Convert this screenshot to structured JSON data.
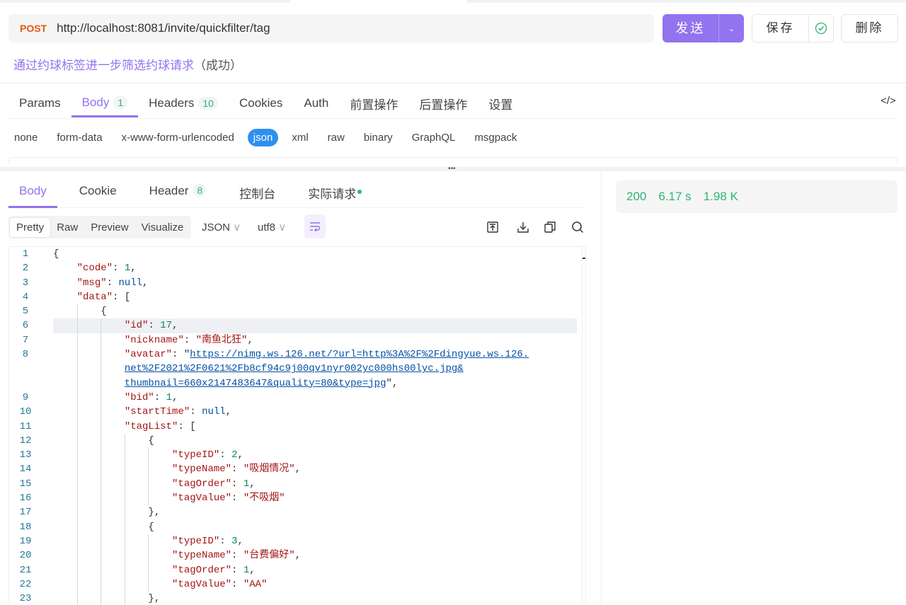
{
  "request": {
    "method": "POST",
    "url": "http://localhost:8081/invite/quickfilter/tag",
    "send_label": "发送",
    "save_label": "保存",
    "delete_label": "删除"
  },
  "description": {
    "title": "通过约球标签进一步筛选约球请求",
    "status": "（成功）"
  },
  "request_tabs": [
    {
      "label": "Params"
    },
    {
      "label": "Body",
      "badge": "1"
    },
    {
      "label": "Headers",
      "badge": "10"
    },
    {
      "label": "Cookies"
    },
    {
      "label": "Auth"
    },
    {
      "label": "前置操作"
    },
    {
      "label": "后置操作"
    },
    {
      "label": "设置"
    }
  ],
  "body_types": [
    "none",
    "form-data",
    "x-www-form-urlencoded",
    "json",
    "xml",
    "raw",
    "binary",
    "GraphQL",
    "msgpack"
  ],
  "response_tabs": [
    {
      "label": "Body"
    },
    {
      "label": "Cookie"
    },
    {
      "label": "Header",
      "badge": "8"
    },
    {
      "label": "控制台"
    },
    {
      "label": "实际请求"
    }
  ],
  "view_modes": [
    "Pretty",
    "Raw",
    "Preview",
    "Visualize"
  ],
  "format_select": "JSON",
  "encoding_select": "utf8",
  "response_status": {
    "code": "200",
    "time": "6.17 s",
    "size": "1.98 K"
  },
  "code_lines": [
    {
      "n": "1",
      "i": 0,
      "t": [
        [
          "p",
          "{"
        ]
      ]
    },
    {
      "n": "2",
      "i": 1,
      "t": [
        [
          "k",
          "\"code\""
        ],
        [
          "p",
          ": "
        ],
        [
          "n",
          "1"
        ],
        [
          "p",
          ","
        ]
      ]
    },
    {
      "n": "3",
      "i": 1,
      "t": [
        [
          "k",
          "\"msg\""
        ],
        [
          "p",
          ": "
        ],
        [
          "nl",
          "null"
        ],
        [
          "p",
          ","
        ]
      ]
    },
    {
      "n": "4",
      "i": 1,
      "t": [
        [
          "k",
          "\"data\""
        ],
        [
          "p",
          ": ["
        ]
      ]
    },
    {
      "n": "5",
      "i": 2,
      "t": [
        [
          "p",
          "{"
        ]
      ]
    },
    {
      "n": "6",
      "i": 3,
      "t": [
        [
          "k",
          "\"id\""
        ],
        [
          "p",
          ": "
        ],
        [
          "n",
          "17"
        ],
        [
          "p",
          ","
        ]
      ],
      "hl": true
    },
    {
      "n": "7",
      "i": 3,
      "t": [
        [
          "k",
          "\"nickname\""
        ],
        [
          "p",
          ": "
        ],
        [
          "s",
          "\"南鱼北狂\""
        ],
        [
          "p",
          ","
        ]
      ]
    },
    {
      "n": "8",
      "i": 3,
      "t": [
        [
          "k",
          "\"avatar\""
        ],
        [
          "p",
          ": \""
        ],
        [
          "u",
          "https://nimg.ws.126.net/?url=http%3A%2F%2Fdingyue.ws.126."
        ]
      ]
    },
    {
      "n": "",
      "i": 3,
      "t": [
        [
          "u",
          "net%2F2021%2F0621%2Fb8cf94c9j00qv1nyr002yc000hs00lyc.jpg&"
        ]
      ]
    },
    {
      "n": "",
      "i": 3,
      "t": [
        [
          "u",
          "thumbnail=660x2147483647&quality=80&type=jpg"
        ],
        [
          "p",
          "\","
        ]
      ]
    },
    {
      "n": "9",
      "i": 3,
      "t": [
        [
          "k",
          "\"bid\""
        ],
        [
          "p",
          ": "
        ],
        [
          "n",
          "1"
        ],
        [
          "p",
          ","
        ]
      ]
    },
    {
      "n": "10",
      "i": 3,
      "t": [
        [
          "k",
          "\"startTime\""
        ],
        [
          "p",
          ": "
        ],
        [
          "nl",
          "null"
        ],
        [
          "p",
          ","
        ]
      ]
    },
    {
      "n": "11",
      "i": 3,
      "t": [
        [
          "k",
          "\"tagList\""
        ],
        [
          "p",
          ": ["
        ]
      ]
    },
    {
      "n": "12",
      "i": 4,
      "t": [
        [
          "p",
          "{"
        ]
      ]
    },
    {
      "n": "13",
      "i": 5,
      "t": [
        [
          "k",
          "\"typeID\""
        ],
        [
          "p",
          ": "
        ],
        [
          "n",
          "2"
        ],
        [
          "p",
          ","
        ]
      ]
    },
    {
      "n": "14",
      "i": 5,
      "t": [
        [
          "k",
          "\"typeName\""
        ],
        [
          "p",
          ": "
        ],
        [
          "s",
          "\"吸烟情况\""
        ],
        [
          "p",
          ","
        ]
      ]
    },
    {
      "n": "15",
      "i": 5,
      "t": [
        [
          "k",
          "\"tagOrder\""
        ],
        [
          "p",
          ": "
        ],
        [
          "n",
          "1"
        ],
        [
          "p",
          ","
        ]
      ]
    },
    {
      "n": "16",
      "i": 5,
      "t": [
        [
          "k",
          "\"tagValue\""
        ],
        [
          "p",
          ": "
        ],
        [
          "s",
          "\"不吸烟\""
        ]
      ]
    },
    {
      "n": "17",
      "i": 4,
      "t": [
        [
          "p",
          "},"
        ]
      ]
    },
    {
      "n": "18",
      "i": 4,
      "t": [
        [
          "p",
          "{"
        ]
      ]
    },
    {
      "n": "19",
      "i": 5,
      "t": [
        [
          "k",
          "\"typeID\""
        ],
        [
          "p",
          ": "
        ],
        [
          "n",
          "3"
        ],
        [
          "p",
          ","
        ]
      ]
    },
    {
      "n": "20",
      "i": 5,
      "t": [
        [
          "k",
          "\"typeName\""
        ],
        [
          "p",
          ": "
        ],
        [
          "s",
          "\"台费偏好\""
        ],
        [
          "p",
          ","
        ]
      ]
    },
    {
      "n": "21",
      "i": 5,
      "t": [
        [
          "k",
          "\"tagOrder\""
        ],
        [
          "p",
          ": "
        ],
        [
          "n",
          "1"
        ],
        [
          "p",
          ","
        ]
      ]
    },
    {
      "n": "22",
      "i": 5,
      "t": [
        [
          "k",
          "\"tagValue\""
        ],
        [
          "p",
          ": "
        ],
        [
          "s",
          "\"AA\""
        ]
      ]
    },
    {
      "n": "23",
      "i": 4,
      "t": [
        [
          "p",
          "},"
        ]
      ]
    }
  ]
}
